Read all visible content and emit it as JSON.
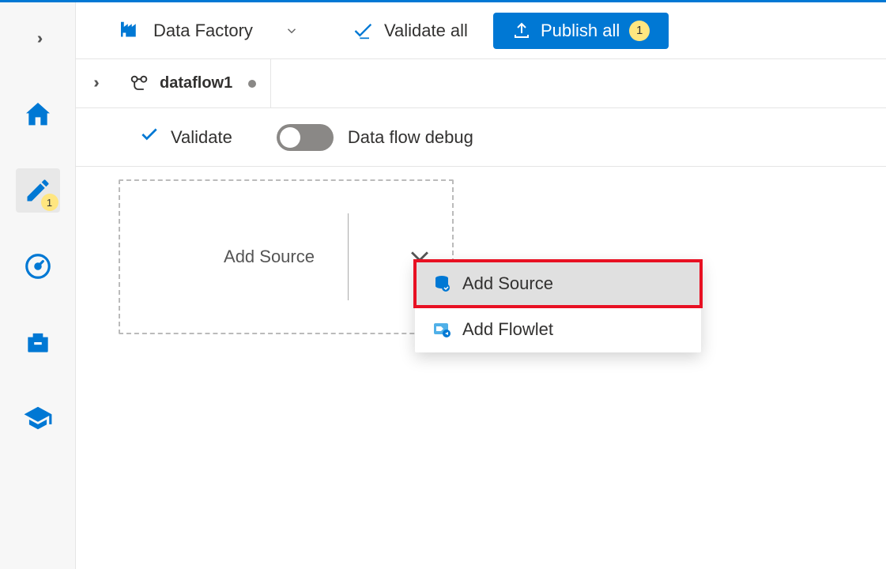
{
  "header": {
    "factory_label": "Data Factory",
    "validate_all_label": "Validate all",
    "publish_label": "Publish all",
    "publish_count": "1"
  },
  "rail": {
    "author_badge": "1"
  },
  "tabs": {
    "active_tab_label": "dataflow1"
  },
  "toolbar": {
    "validate_label": "Validate",
    "debug_label": "Data flow debug"
  },
  "canvas": {
    "add_source_label": "Add Source"
  },
  "menu": {
    "add_source_label": "Add Source",
    "add_flowlet_label": "Add Flowlet"
  }
}
